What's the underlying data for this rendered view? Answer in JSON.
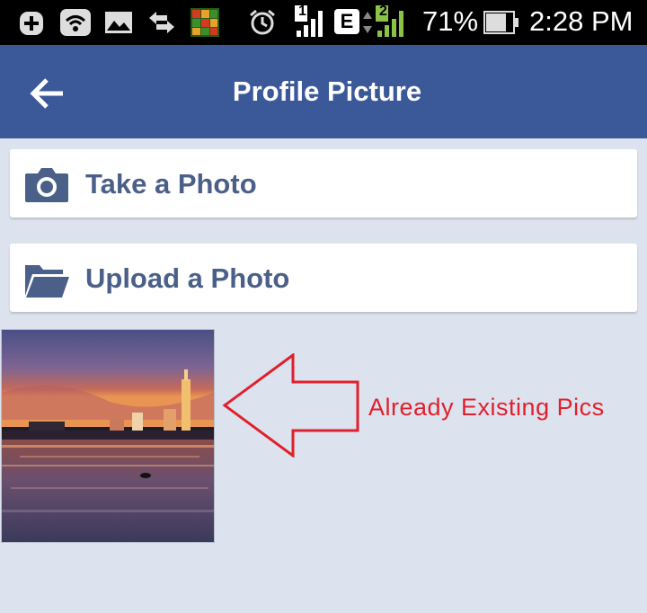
{
  "status_bar": {
    "icons": [
      "plus-box-icon",
      "wifi-icon",
      "image-icon",
      "data-transfer-icon",
      "app-icon",
      "alarm-icon",
      "signal-1-icon",
      "edge-icon",
      "signal-2-icon"
    ],
    "sim1_label": "1",
    "network_type": "E",
    "sim2_label": "2",
    "battery_percent": "71%",
    "time": "2:28 PM"
  },
  "app_bar": {
    "title": "Profile Picture",
    "background_color": "#3b5998",
    "back_icon": "arrow-left-icon"
  },
  "options": [
    {
      "label": "Take a Photo",
      "icon": "camera-icon"
    },
    {
      "label": "Upload a Photo",
      "icon": "folder-open-icon"
    }
  ],
  "photos": [
    {
      "description_icon": "city-skyline-sunset-photo"
    }
  ],
  "annotation": {
    "text": "Already Existing Pics",
    "color": "#e0202c"
  },
  "colors": {
    "background": "#dde3ee",
    "option_text": "#4b6088"
  }
}
